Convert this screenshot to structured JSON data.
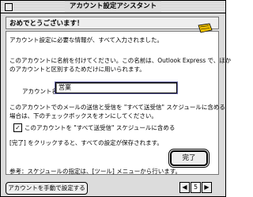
{
  "window": {
    "title": "アカウント設定アシスタント"
  },
  "header": {
    "text": "おめでとうございます！"
  },
  "body": {
    "line1": "アカウント設定に必要な情報が、すべて入力されました。",
    "line2a": "このアカウントに名前を付けてください。この名前は、Outlook Express で、ほか",
    "line2b": "のアカウントと区別するためだけに用いられます。",
    "name_label": "アカウント名：",
    "name_value": "営業",
    "line3a": "このアカウントでのメールの送信と受信を \"すべて送受信\" スケジュールに含める",
    "line3b": "場合は、下のチェックボックスをオンにしてください。",
    "checkbox_label": "このアカウントを \"すべて送受信\" スケジュールに含める",
    "checkbox_mark": "✓",
    "line4": "[完了] をクリックすると、すべての設定が保存されます。",
    "note": "参考：スケジュールの指定は、[ツール] メニューから行います。"
  },
  "buttons": {
    "done": "完了",
    "manual": "アカウントを手動で設定する",
    "prev": "◀",
    "page": "5",
    "next": "▶"
  },
  "colors": {
    "logo_yellow": "#f2c200",
    "focus_ring": "#6a6aa8"
  }
}
